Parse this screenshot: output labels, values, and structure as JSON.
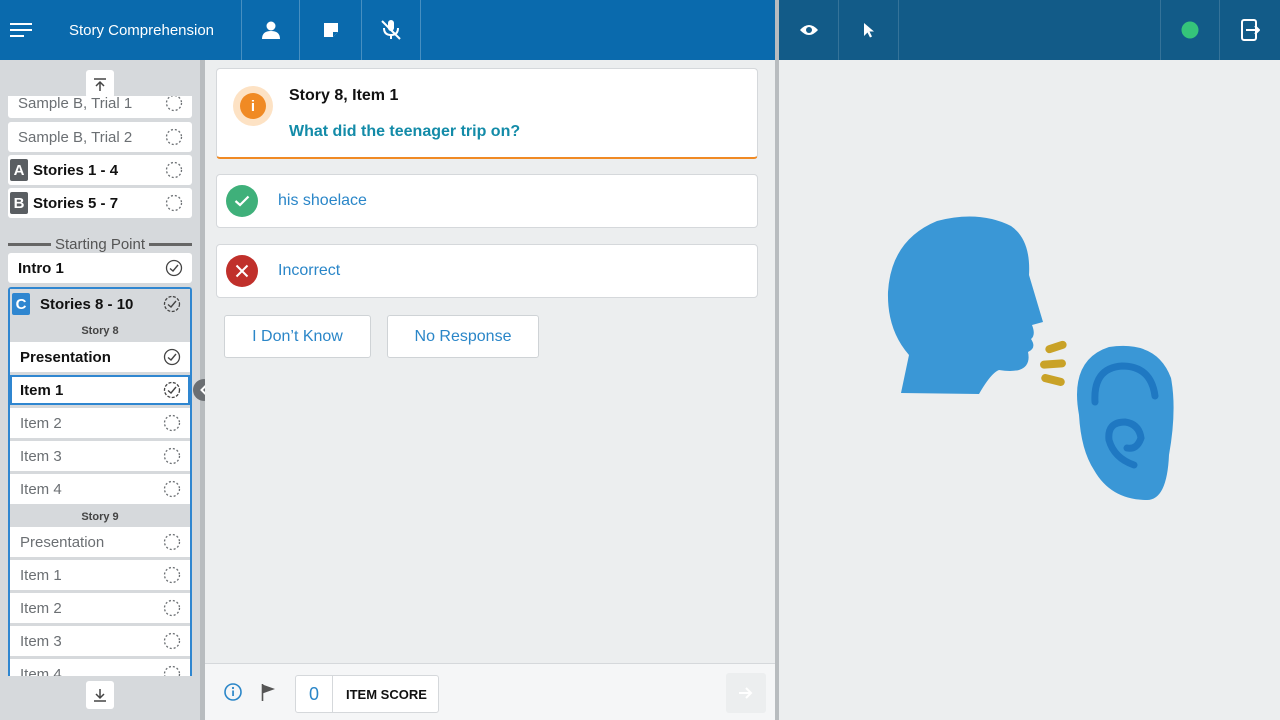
{
  "header": {
    "title": "Story Comprehension",
    "status_color": "#35c47a"
  },
  "sidebar": {
    "rows_top": [
      {
        "label": "Sample B, Trial 1"
      },
      {
        "label": "Sample B, Trial 2"
      },
      {
        "letter": "A",
        "label": "Stories 1 - 4",
        "letter_color": "#5a5e62"
      },
      {
        "letter": "B",
        "label": "Stories 5 - 7",
        "letter_color": "#5a5e62"
      }
    ],
    "starting_point": "Starting Point",
    "intro": "Intro 1",
    "section_c": {
      "letter": "C",
      "label": "Stories 8 - 10",
      "letter_color": "#2f86d0"
    },
    "story8_header": "Story 8",
    "story8_items": [
      "Presentation",
      "Item 1",
      "Item 2",
      "Item 3",
      "Item 4"
    ],
    "story9_header": "Story 9",
    "story9_items": [
      "Presentation",
      "Item 1",
      "Item 2",
      "Item 3",
      "Item 4"
    ]
  },
  "question": {
    "title": "Story 8, Item 1",
    "text": "What did the teenager trip on?",
    "info_glyph": "i"
  },
  "answers": {
    "correct": {
      "label": "his shoelace",
      "color": "#3fb07a"
    },
    "incorrect": {
      "label": "Incorrect",
      "color": "#c0302b"
    }
  },
  "options": {
    "dont_know": "I Don’t Know",
    "no_response": "No Response"
  },
  "footer": {
    "score": "0",
    "score_label": "ITEM SCORE"
  },
  "illustration": {
    "head_color": "#3a97d6",
    "sound_color": "#c9a227",
    "icon": "speaking-head-ear-illustration"
  }
}
